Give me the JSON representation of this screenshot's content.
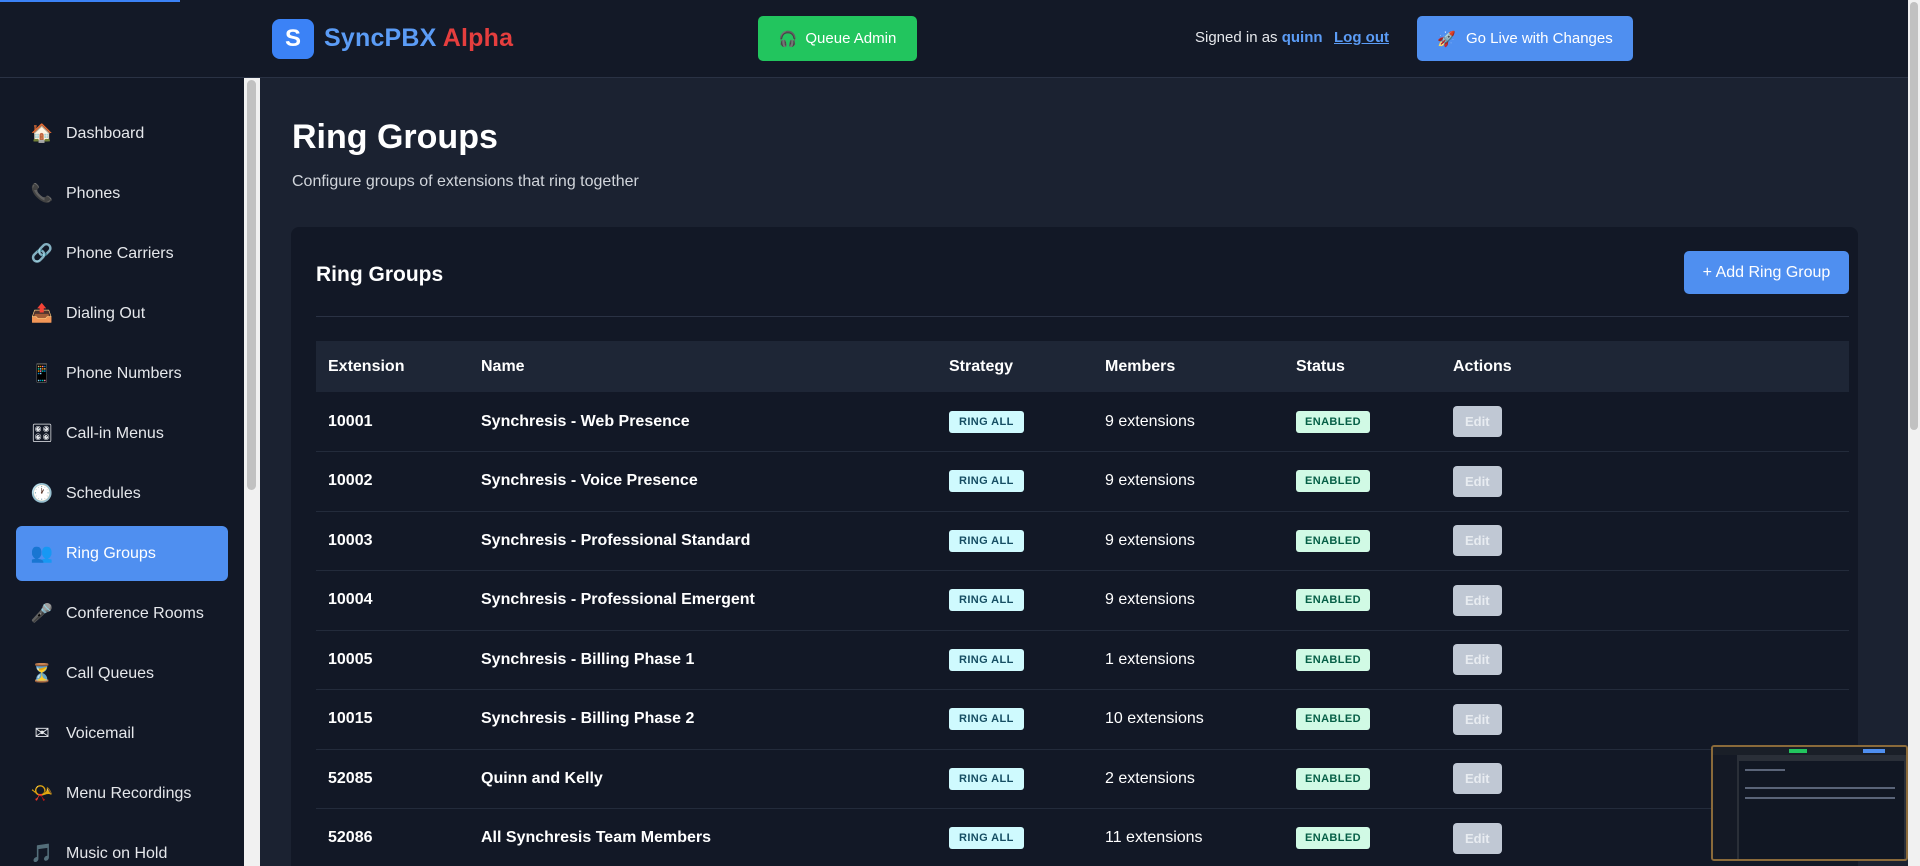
{
  "header": {
    "logo_letter": "S",
    "brand_name": "SyncPBX",
    "brand_suffix": "Alpha",
    "queue_admin_label": "Queue Admin",
    "queue_admin_icon": "headset-icon",
    "signed_in_prefix": "Signed in as",
    "username": "quinn",
    "logout_label": "Log out",
    "go_live_label": "Go Live with Changes",
    "go_live_icon": "rocket-icon"
  },
  "sidebar": {
    "items": [
      {
        "label": "Dashboard",
        "icon": "🏠",
        "active": false
      },
      {
        "label": "Phones",
        "icon": "📞",
        "active": false
      },
      {
        "label": "Phone Carriers",
        "icon": "🔗",
        "active": false
      },
      {
        "label": "Dialing Out",
        "icon": "📤",
        "active": false
      },
      {
        "label": "Phone Numbers",
        "icon": "📱",
        "active": false
      },
      {
        "label": "Call-in Menus",
        "icon": "🎛",
        "active": false
      },
      {
        "label": "Schedules",
        "icon": "🕐",
        "active": false
      },
      {
        "label": "Ring Groups",
        "icon": "👥",
        "active": true
      },
      {
        "label": "Conference Rooms",
        "icon": "🎤",
        "active": false
      },
      {
        "label": "Call Queues",
        "icon": "⏳",
        "active": false
      },
      {
        "label": "Voicemail",
        "icon": "✉",
        "active": false
      },
      {
        "label": "Menu Recordings",
        "icon": "📯",
        "active": false
      },
      {
        "label": "Music on Hold",
        "icon": "🎵",
        "active": false
      }
    ]
  },
  "page": {
    "title": "Ring Groups",
    "subtitle": "Configure groups of extensions that ring together"
  },
  "card": {
    "title": "Ring Groups",
    "add_button_label": "+ Add Ring Group"
  },
  "table": {
    "headers": {
      "extension": "Extension",
      "name": "Name",
      "strategy": "Strategy",
      "members": "Members",
      "status": "Status",
      "actions": "Actions"
    },
    "rows": [
      {
        "extension": "10001",
        "name": "Synchresis - Web Presence",
        "strategy": "RING ALL",
        "members": "9 extensions",
        "status": "ENABLED",
        "action": "Edit"
      },
      {
        "extension": "10002",
        "name": "Synchresis - Voice Presence",
        "strategy": "RING ALL",
        "members": "9 extensions",
        "status": "ENABLED",
        "action": "Edit"
      },
      {
        "extension": "10003",
        "name": "Synchresis - Professional Standard",
        "strategy": "RING ALL",
        "members": "9 extensions",
        "status": "ENABLED",
        "action": "Edit"
      },
      {
        "extension": "10004",
        "name": "Synchresis - Professional Emergent",
        "strategy": "RING ALL",
        "members": "9 extensions",
        "status": "ENABLED",
        "action": "Edit"
      },
      {
        "extension": "10005",
        "name": "Synchresis - Billing Phase 1",
        "strategy": "RING ALL",
        "members": "1 extensions",
        "status": "ENABLED",
        "action": "Edit"
      },
      {
        "extension": "10015",
        "name": "Synchresis - Billing Phase 2",
        "strategy": "RING ALL",
        "members": "10 extensions",
        "status": "ENABLED",
        "action": "Edit"
      },
      {
        "extension": "52085",
        "name": "Quinn and Kelly",
        "strategy": "RING ALL",
        "members": "2 extensions",
        "status": "ENABLED",
        "action": "Edit"
      },
      {
        "extension": "52086",
        "name": "All Synchresis Team Members",
        "strategy": "RING ALL",
        "members": "11 extensions",
        "status": "ENABLED",
        "action": "Edit"
      }
    ]
  },
  "colors": {
    "accent": "#4f8ff0",
    "success": "#22c55e",
    "brand_suffix": "#e53e3e",
    "background": "#1b2231"
  }
}
